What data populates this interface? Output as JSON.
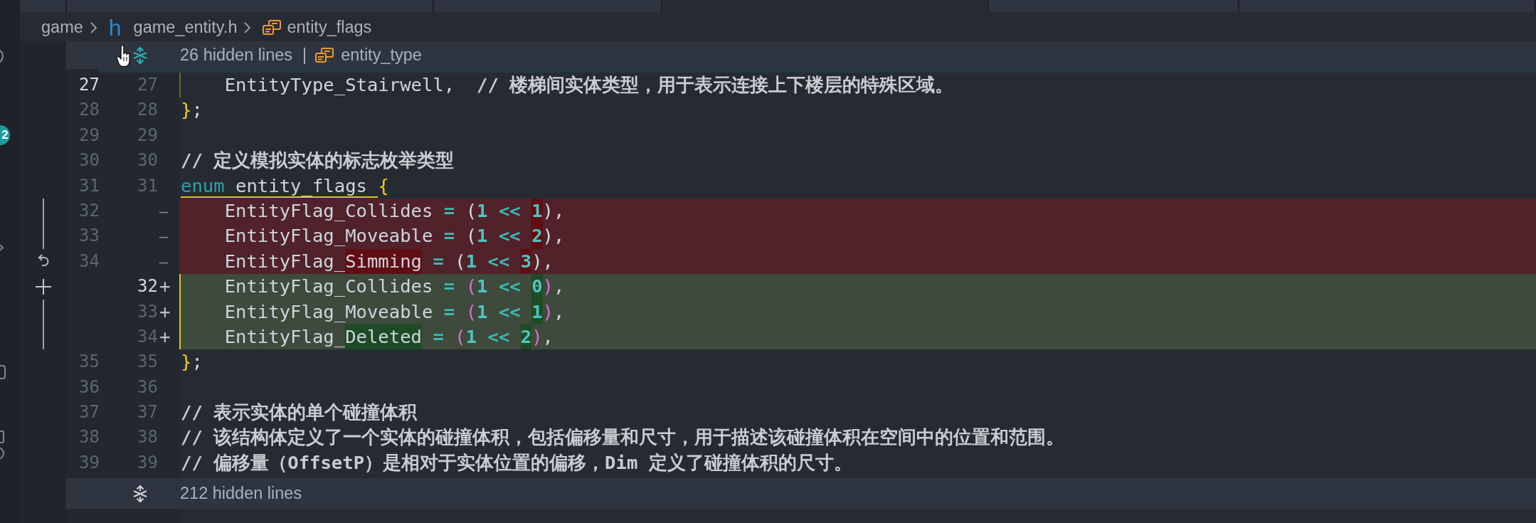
{
  "activity_bar": {
    "badge": "2"
  },
  "tabs": [
    {
      "selected": false
    },
    {
      "selected": false
    },
    {
      "selected": false
    },
    {
      "selected": true
    },
    {
      "selected": false
    },
    {
      "selected": false
    }
  ],
  "breadcrumb": [
    {
      "kind": "folder",
      "label": "game"
    },
    {
      "kind": "file",
      "icon": "h",
      "label": "game_entity.h"
    },
    {
      "kind": "symbol",
      "label": "entity_flags"
    }
  ],
  "fold_above": {
    "hidden": "26 hidden lines",
    "separator": "|",
    "symbol": "entity_type",
    "hovered": true
  },
  "lines": [
    {
      "kind": "context",
      "old_number": "27",
      "old_active": true,
      "new_number": "27",
      "new_active": false,
      "guide": {
        "kind": "vertical",
        "active": false
      },
      "tokens": [
        {
          "text": "    EntityType_Stairwell,  ",
          "kind": "ident"
        },
        {
          "text": "// 楼梯间实体类型，用于表示连接上下楼层的特殊区域。",
          "kind": "comment"
        }
      ]
    },
    {
      "kind": "context",
      "old_number": "28",
      "old_active": false,
      "new_number": "28",
      "new_active": false,
      "tokens": [
        {
          "text": "}",
          "kind": "brace"
        },
        {
          "text": ";",
          "kind": "punct"
        }
      ]
    },
    {
      "kind": "context",
      "old_number": "29",
      "old_active": false,
      "new_number": "29",
      "new_active": false
    },
    {
      "kind": "context",
      "old_number": "30",
      "old_active": false,
      "new_number": "30",
      "new_active": false,
      "tokens": [
        {
          "text": "// 定义模拟实体的标志枚举类型",
          "kind": "comment"
        }
      ]
    },
    {
      "kind": "context",
      "old_number": "31",
      "old_active": false,
      "new_number": "31",
      "new_active": false,
      "guide": {
        "kind": "underline",
        "active": true
      },
      "tokens": [
        {
          "text": "enum",
          "kind": "keyword"
        },
        {
          "text": " entity_flags ",
          "kind": "ident"
        },
        {
          "text": "{",
          "kind": "brace"
        }
      ]
    },
    {
      "kind": "removed",
      "old_number": "32",
      "old_active": false,
      "marker": "—",
      "margin": {
        "kind": "rule"
      },
      "tokens": [
        {
          "text": "    EntityFlag_Collides",
          "kind": "ident",
          "changed": false
        },
        {
          "text": " = ",
          "kind": "operator",
          "changed": false
        },
        {
          "text": "(",
          "kind": "punct",
          "changed": false
        },
        {
          "text": "1",
          "kind": "number",
          "changed": false
        },
        {
          "text": " << ",
          "kind": "operator",
          "changed": false
        },
        {
          "text": "1",
          "kind": "number",
          "changed": true
        },
        {
          "text": ")",
          "kind": "punct",
          "changed": false
        },
        {
          "text": ",",
          "kind": "punct",
          "changed": false
        }
      ]
    },
    {
      "kind": "removed",
      "old_number": "33",
      "old_active": false,
      "marker": "—",
      "margin": {
        "kind": "rule"
      },
      "tokens": [
        {
          "text": "    EntityFlag_Moveable",
          "kind": "ident",
          "changed": false
        },
        {
          "text": " = ",
          "kind": "operator",
          "changed": false
        },
        {
          "text": "(",
          "kind": "punct",
          "changed": false
        },
        {
          "text": "1",
          "kind": "number",
          "changed": false
        },
        {
          "text": " << ",
          "kind": "operator",
          "changed": false
        },
        {
          "text": "2",
          "kind": "number",
          "changed": true
        },
        {
          "text": ")",
          "kind": "punct",
          "changed": false
        },
        {
          "text": ",",
          "kind": "punct",
          "changed": false
        }
      ]
    },
    {
      "kind": "removed",
      "old_number": "34",
      "old_active": false,
      "marker": "—",
      "margin": {
        "kind": "revert"
      },
      "tokens": [
        {
          "text": "    EntityFlag_",
          "kind": "ident",
          "changed": false
        },
        {
          "text": "Simming",
          "kind": "ident",
          "changed": true
        },
        {
          "text": " = ",
          "kind": "operator",
          "changed": false
        },
        {
          "text": "(",
          "kind": "punct",
          "changed": false
        },
        {
          "text": "1",
          "kind": "number",
          "changed": false
        },
        {
          "text": " << ",
          "kind": "operator",
          "changed": false
        },
        {
          "text": "3",
          "kind": "number",
          "changed": true
        },
        {
          "text": ")",
          "kind": "punct",
          "changed": false
        },
        {
          "text": ",",
          "kind": "punct",
          "changed": false
        }
      ]
    },
    {
      "kind": "added",
      "new_number": "32",
      "new_active": true,
      "marker": "+",
      "margin": {
        "kind": "stage"
      },
      "guide": {
        "kind": "vertical",
        "active": true
      },
      "tokens": [
        {
          "text": "    EntityFlag_Collides",
          "kind": "ident",
          "changed": false
        },
        {
          "text": " = ",
          "kind": "operator",
          "changed": false
        },
        {
          "text": "(",
          "kind": "bracket",
          "changed": false
        },
        {
          "text": "1",
          "kind": "number",
          "changed": false
        },
        {
          "text": " << ",
          "kind": "operator",
          "changed": false
        },
        {
          "text": "0",
          "kind": "number",
          "changed": true
        },
        {
          "text": ")",
          "kind": "bracket",
          "changed": false
        },
        {
          "text": ",",
          "kind": "punct",
          "changed": false
        }
      ]
    },
    {
      "kind": "added",
      "new_number": "33",
      "new_active": false,
      "marker": "+",
      "margin": {
        "kind": "rule"
      },
      "guide": {
        "kind": "vertical",
        "active": true
      },
      "tokens": [
        {
          "text": "    EntityFlag_Moveable",
          "kind": "ident",
          "changed": false
        },
        {
          "text": " = ",
          "kind": "operator",
          "changed": false
        },
        {
          "text": "(",
          "kind": "bracket",
          "changed": false
        },
        {
          "text": "1",
          "kind": "number",
          "changed": false
        },
        {
          "text": " << ",
          "kind": "operator",
          "changed": false
        },
        {
          "text": "1",
          "kind": "number",
          "changed": true
        },
        {
          "text": ")",
          "kind": "bracket",
          "changed": false
        },
        {
          "text": ",",
          "kind": "punct",
          "changed": false
        }
      ]
    },
    {
      "kind": "added",
      "new_number": "34",
      "new_active": false,
      "marker": "+",
      "margin": {
        "kind": "rule"
      },
      "guide": {
        "kind": "vertical",
        "active": true
      },
      "tokens": [
        {
          "text": "    EntityFlag_",
          "kind": "ident",
          "changed": false
        },
        {
          "text": "Deleted",
          "kind": "ident",
          "changed": true
        },
        {
          "text": " = ",
          "kind": "operator",
          "changed": false
        },
        {
          "text": "(",
          "kind": "bracket",
          "changed": false
        },
        {
          "text": "1",
          "kind": "number",
          "changed": false
        },
        {
          "text": " << ",
          "kind": "operator",
          "changed": false
        },
        {
          "text": "2",
          "kind": "number",
          "changed": true
        },
        {
          "text": ")",
          "kind": "bracket",
          "changed": false
        },
        {
          "text": ",",
          "kind": "punct",
          "changed": false
        }
      ]
    },
    {
      "kind": "context",
      "old_number": "35",
      "old_active": false,
      "new_number": "35",
      "new_active": false,
      "tokens": [
        {
          "text": "}",
          "kind": "brace"
        },
        {
          "text": ";",
          "kind": "punct"
        }
      ]
    },
    {
      "kind": "context",
      "old_number": "36",
      "old_active": false,
      "new_number": "36",
      "new_active": false
    },
    {
      "kind": "context",
      "old_number": "37",
      "old_active": false,
      "new_number": "37",
      "new_active": false,
      "tokens": [
        {
          "text": "// 表示实体的单个碰撞体积",
          "kind": "comment"
        }
      ]
    },
    {
      "kind": "context",
      "old_number": "38",
      "old_active": false,
      "new_number": "38",
      "new_active": false,
      "tokens": [
        {
          "text": "// 该结构体定义了一个实体的碰撞体积，包括偏移量和尺寸，用于描述该碰撞体积在空间中的位置和范围。",
          "kind": "comment"
        }
      ]
    },
    {
      "kind": "context",
      "old_number": "39",
      "old_active": false,
      "new_number": "39",
      "new_active": false,
      "tokens": [
        {
          "text": "// 偏移量（OffsetP）是相对于实体位置的偏移，Dim 定义了碰撞体积的尺寸。",
          "kind": "comment"
        }
      ]
    }
  ],
  "fold_below": {
    "hidden": "212 hidden lines",
    "hovered": false
  }
}
